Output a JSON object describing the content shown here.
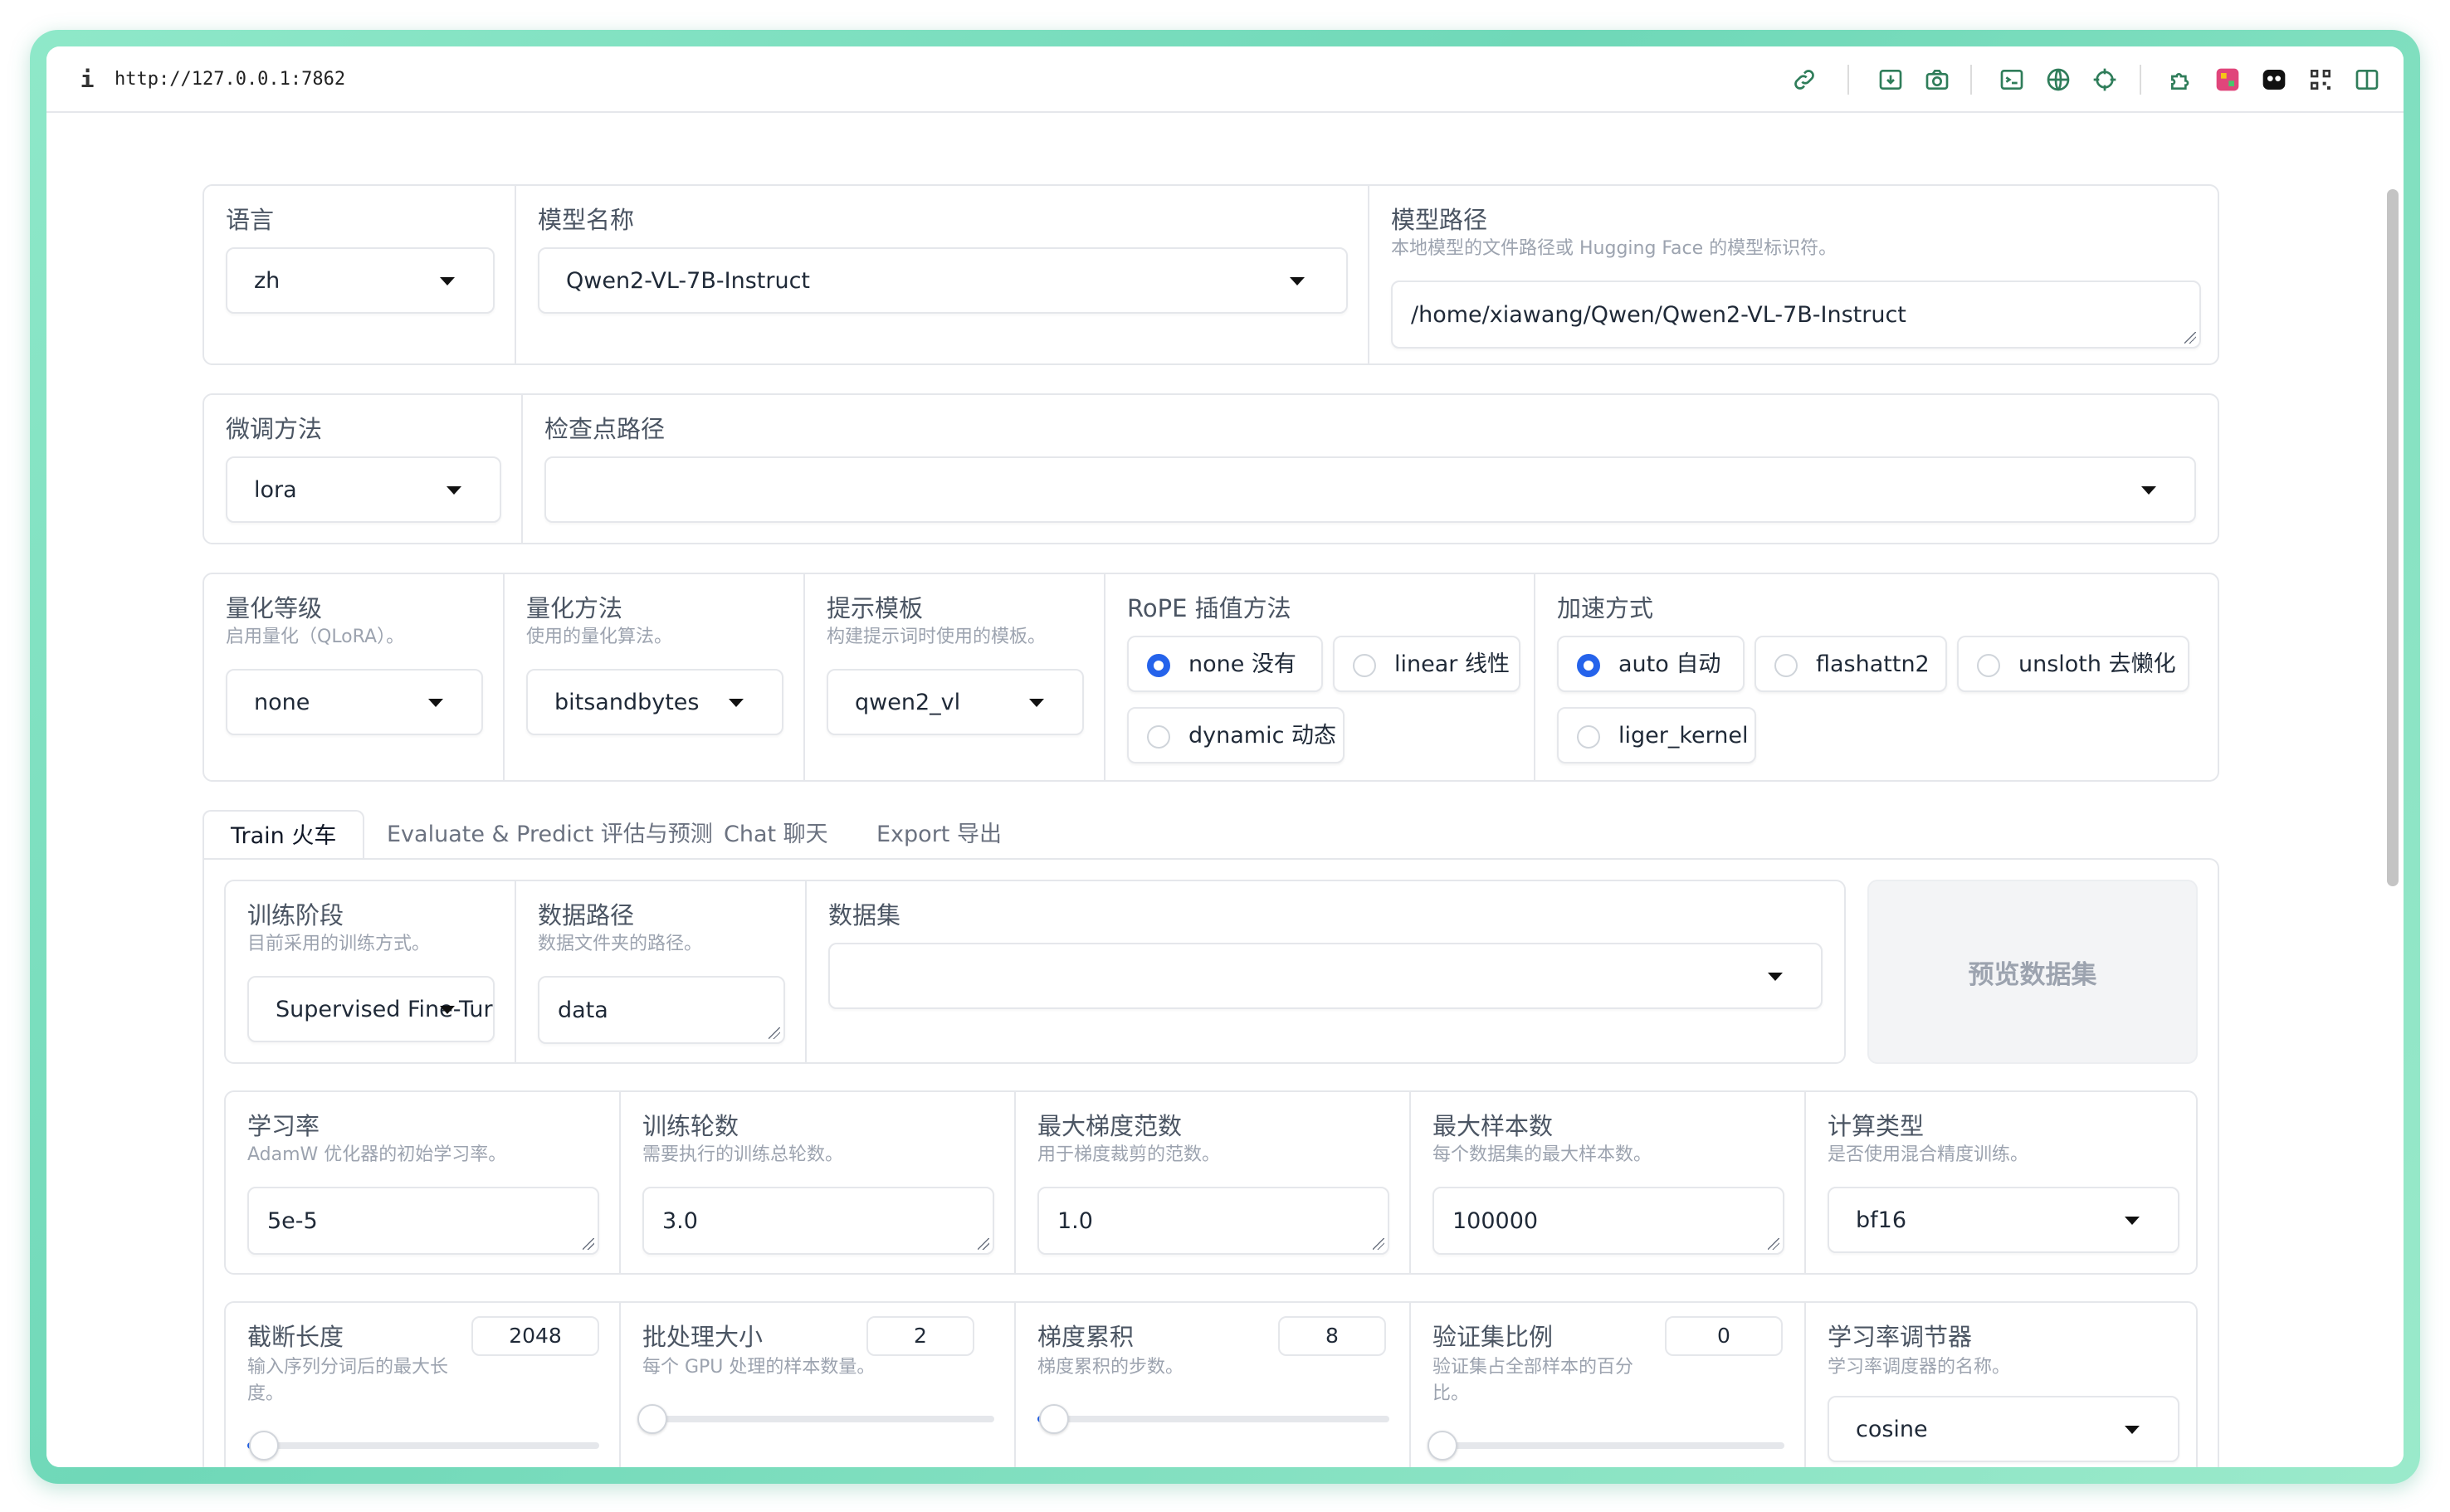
{
  "browser": {
    "url": "http://127.0.0.1:7862",
    "info_icon": "i",
    "toolbar_icons": [
      "link-icon",
      "download-icon",
      "camera-icon",
      "terminal-icon",
      "globe-icon",
      "crosshair-icon",
      "extension-icon",
      "extension-2-icon",
      "extension-3-icon",
      "qr-code-icon",
      "sidebar-icon"
    ]
  },
  "top": {
    "language": {
      "label": "语言",
      "value": "zh"
    },
    "model_name": {
      "label": "模型名称",
      "value": "Qwen2-VL-7B-Instruct"
    },
    "model_path": {
      "label": "模型路径",
      "hint": "本地模型的文件路径或 Hugging Face 的模型标识符。",
      "value": "/home/xiawang/Qwen/Qwen2-VL-7B-Instruct"
    }
  },
  "row2": {
    "finetune": {
      "label": "微调方法",
      "value": "lora"
    },
    "checkpoint": {
      "label": "检查点路径",
      "value": ""
    }
  },
  "row3": {
    "quant_bit": {
      "label": "量化等级",
      "hint": "启用量化（QLoRA）。",
      "value": "none"
    },
    "quant_method": {
      "label": "量化方法",
      "hint": "使用的量化算法。",
      "value": "bitsandbytes"
    },
    "template": {
      "label": "提示模板",
      "hint": "构建提示词时使用的模板。",
      "value": "qwen2_vl"
    },
    "rope": {
      "label": "RoPE 插值方法",
      "options": [
        "none 没有",
        "linear 线性",
        "dynamic 动态"
      ],
      "selected": "none 没有"
    },
    "booster": {
      "label": "加速方式",
      "options": [
        "auto 自动",
        "flashattn2",
        "unsloth 去懒化",
        "liger_kernel"
      ],
      "selected": "auto 自动"
    }
  },
  "tabs": [
    {
      "label": "Train 火车",
      "active": true
    },
    {
      "label": "Evaluate & Predict 评估与预测",
      "active": false
    },
    {
      "label": "Chat 聊天",
      "active": false
    },
    {
      "label": "Export 导出",
      "active": false
    }
  ],
  "train": {
    "stage": {
      "label": "训练阶段",
      "hint": "目前采用的训练方式。",
      "value": "Supervised Fine-Tur"
    },
    "dataset_dir": {
      "label": "数据路径",
      "hint": "数据文件夹的路径。",
      "value": "data"
    },
    "dataset": {
      "label": "数据集",
      "value": ""
    },
    "preview_button": "预览数据集",
    "lr": {
      "label": "学习率",
      "hint": "AdamW 优化器的初始学习率。",
      "value": "5e-5"
    },
    "epochs": {
      "label": "训练轮数",
      "hint": "需要执行的训练总轮数。",
      "value": "3.0"
    },
    "max_grad_norm": {
      "label": "最大梯度范数",
      "hint": "用于梯度裁剪的范数。",
      "value": "1.0"
    },
    "max_samples": {
      "label": "最大样本数",
      "hint": "每个数据集的最大样本数。",
      "value": "100000"
    },
    "compute_type": {
      "label": "计算类型",
      "hint": "是否使用混合精度训练。",
      "value": "bf16"
    },
    "cutoff_len": {
      "label": "截断长度",
      "hint_line1": "输入序列分词后的最大长",
      "hint_line2": "度。",
      "value": "2048",
      "fraction": 0.02
    },
    "batch_size": {
      "label": "批处理大小",
      "hint": "每个 GPU 处理的样本数量。",
      "value": "2",
      "fraction": 0.0
    },
    "grad_accum": {
      "label": "梯度累积",
      "hint": "梯度累积的步数。",
      "value": "8",
      "fraction": 0.02
    },
    "val_size": {
      "label": "验证集比例",
      "hint_line1": "验证集占全部样本的百分",
      "hint_line2": "比。",
      "value": "0",
      "fraction": 0.0
    },
    "lr_scheduler": {
      "label": "学习率调节器",
      "hint": "学习率调度器的名称。",
      "value": "cosine"
    }
  }
}
